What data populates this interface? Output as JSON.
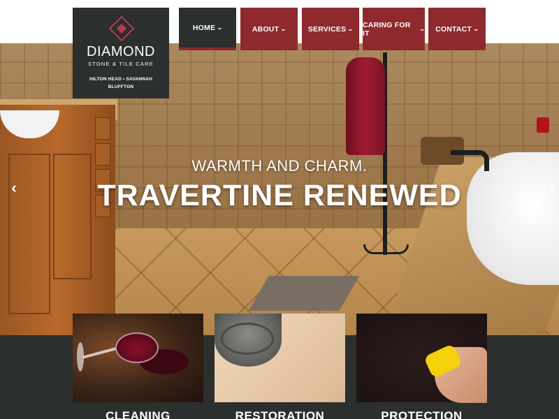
{
  "brand": {
    "name": "DIAMOND",
    "tagline": "STONE & TILE CARE",
    "locations_line1": "HILTON HEAD • SAVANNAH",
    "locations_line2": "BLUFFTON"
  },
  "nav": {
    "items": [
      {
        "label": "HOME",
        "active": true
      },
      {
        "label": "ABOUT",
        "active": false
      },
      {
        "label": "SERVICES",
        "active": false
      },
      {
        "label": "CARING FOR IT",
        "active": false
      },
      {
        "label": "CONTACT",
        "active": false
      }
    ],
    "dropdown_icon": "chevron-down-icon"
  },
  "hero": {
    "subtitle": "WARMTH AND CHARM.",
    "title": "TRAVERTINE RENEWED",
    "prev_icon": "‹",
    "next_icon": "›"
  },
  "services": [
    {
      "title": "CLEANING"
    },
    {
      "title": "RESTORATION"
    },
    {
      "title": "PROTECTION"
    }
  ],
  "colors": {
    "nav_red": "#8e2a2d",
    "dark_charcoal": "#2b2f2d",
    "logo_accent": "#b83b4f",
    "white": "#ffffff"
  }
}
